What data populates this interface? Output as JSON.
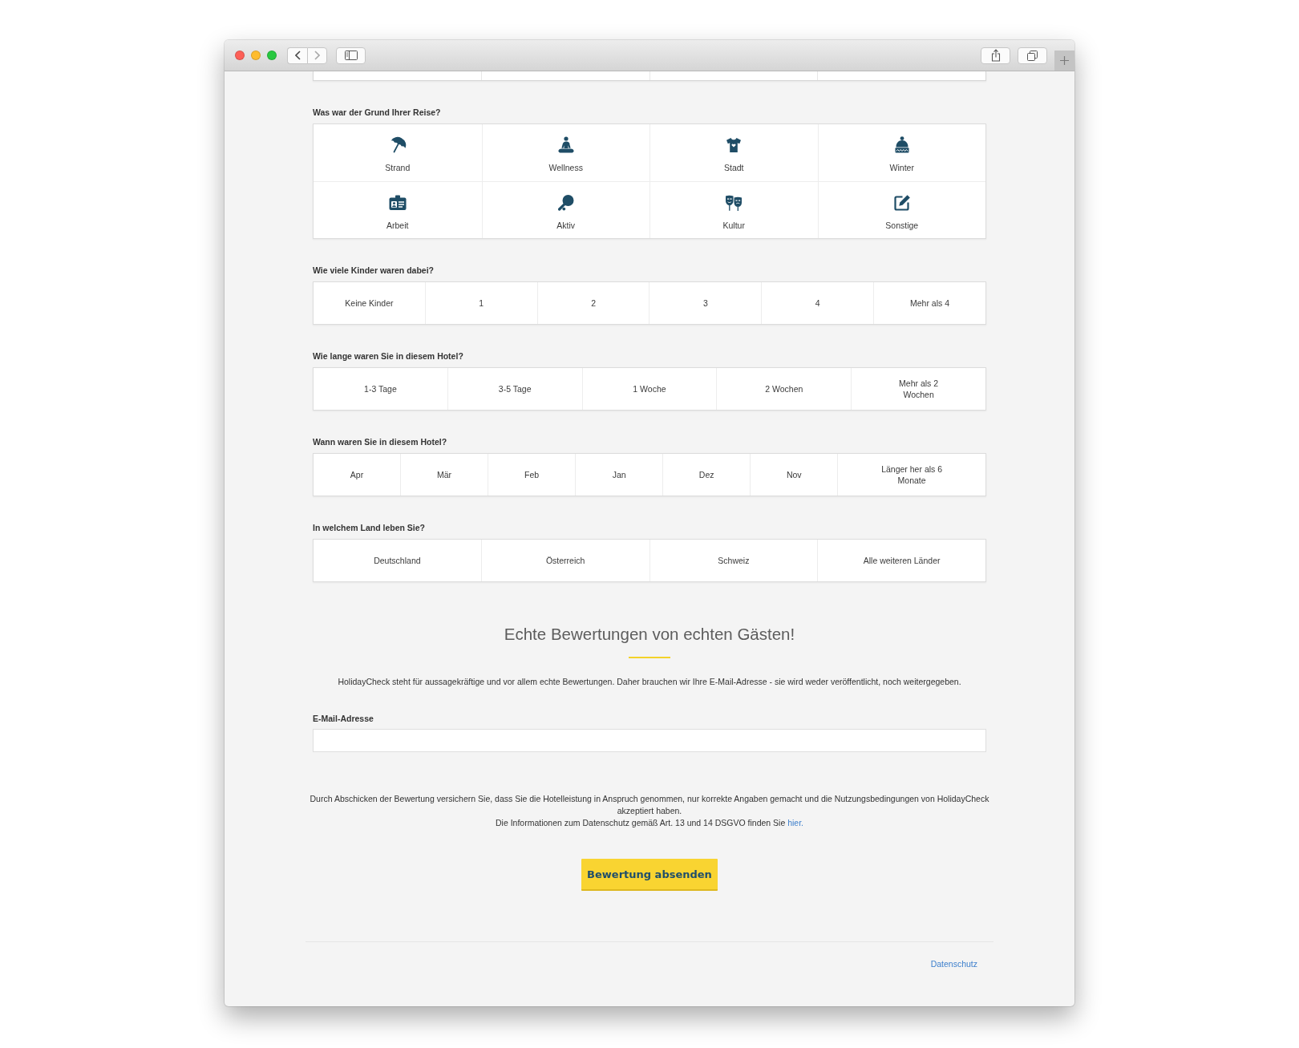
{
  "questions": [
    {
      "kind": "icon_grid",
      "label": "Was war der Grund Ihrer Reise?",
      "options": [
        {
          "label": "Strand",
          "selected": false
        },
        {
          "label": "Wellness",
          "selected": false
        },
        {
          "label": "Stadt",
          "selected": false
        },
        {
          "label": "Winter",
          "selected": false
        },
        {
          "label": "Arbeit",
          "selected": false
        },
        {
          "label": "Aktiv",
          "selected": false
        },
        {
          "label": "Kultur",
          "selected": false
        },
        {
          "label": "Sonstige",
          "selected": false
        }
      ]
    },
    {
      "kind": "choice_row",
      "label": "Wie viele Kinder waren dabei?",
      "options": [
        {
          "label": "Keine Kinder",
          "selected": false
        },
        {
          "label": "1",
          "selected": false
        },
        {
          "label": "2",
          "selected": false
        },
        {
          "label": "3",
          "selected": false
        },
        {
          "label": "4",
          "selected": false
        },
        {
          "label": "Mehr als 4",
          "selected": false
        }
      ]
    },
    {
      "kind": "choice_row",
      "label": "Wie lange waren Sie in diesem Hotel?",
      "options": [
        {
          "label": "1-3 Tage",
          "selected": false
        },
        {
          "label": "3-5 Tage",
          "selected": false
        },
        {
          "label": "1 Woche",
          "selected": false
        },
        {
          "label": "2 Wochen",
          "selected": false
        },
        {
          "label": "Mehr als 2 Wochen",
          "selected": false
        }
      ]
    },
    {
      "kind": "month_row",
      "label": "Wann waren Sie in diesem Hotel?",
      "options": [
        {
          "label": "Apr",
          "selected": false
        },
        {
          "label": "Mär",
          "selected": false
        },
        {
          "label": "Feb",
          "selected": false
        },
        {
          "label": "Jan",
          "selected": false
        },
        {
          "label": "Dez",
          "selected": false
        },
        {
          "label": "Nov",
          "selected": false
        },
        {
          "label": "Länger her als 6 Monate",
          "selected": false
        }
      ]
    },
    {
      "kind": "choice_row",
      "label": "In welchem Land leben Sie?",
      "options": [
        {
          "label": "Deutschland",
          "selected": false
        },
        {
          "label": "Österreich",
          "selected": false
        },
        {
          "label": "Schweiz",
          "selected": false
        },
        {
          "label": "Alle weiteren Länder",
          "selected": false
        }
      ]
    }
  ],
  "verification": {
    "title": "Echte Bewertungen von echten Gästen!",
    "text": "HolidayCheck steht für aussagekräftige und vor allem echte Bewertungen. Daher brauchen wir Ihre E-Mail-Adresse - sie wird weder veröffentlicht, noch weitergegeben."
  },
  "email_field": {
    "label": "E-Mail-Adresse"
  },
  "disclaimer": {
    "text": "Durch Abschicken der Bewertung versichern Sie, dass Sie die Hotelleistung in Anspruch genommen, nur korrekte Angaben gemacht und die Nutzungsbedingungen von HolidayCheck akzeptiert haben.",
    "privacy_text": "Die Informationen zum Datenschutz gemäß Art. 13 und 14 DSGVO finden Sie",
    "privacy_link": "hier."
  },
  "submit_button": {
    "label": "Bewertung absenden"
  },
  "footer": {
    "links": [
      "Datenschutz"
    ]
  }
}
